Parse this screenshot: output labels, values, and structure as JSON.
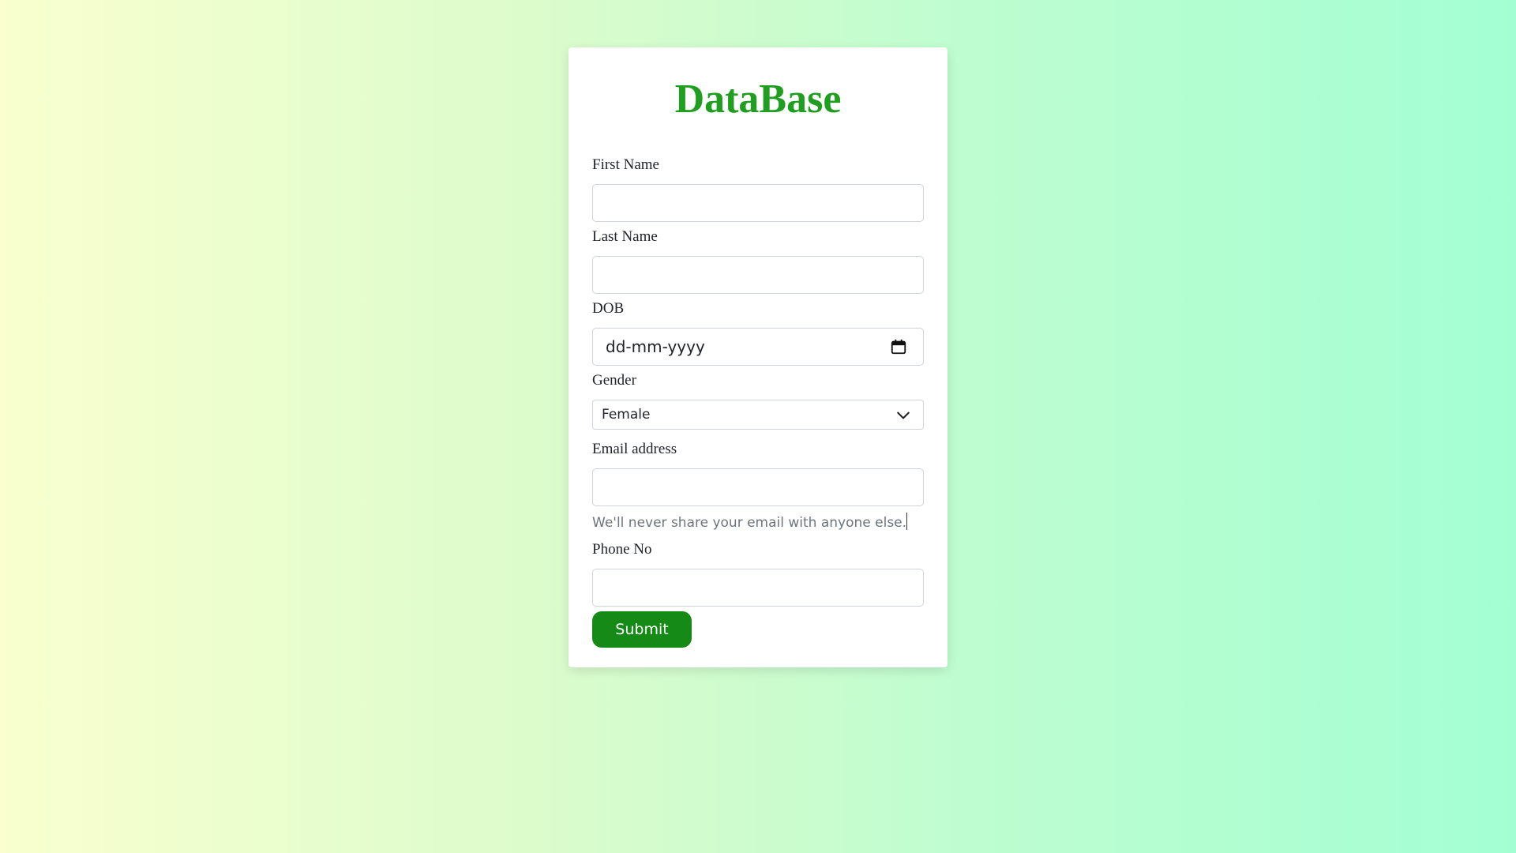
{
  "form": {
    "title": "DataBase",
    "first_name": {
      "label": "First Name",
      "value": ""
    },
    "last_name": {
      "label": "Last Name",
      "value": ""
    },
    "dob": {
      "label": "DOB",
      "placeholder": "dd-mm-yyyy"
    },
    "gender": {
      "label": "Gender",
      "selected": "Female"
    },
    "email": {
      "label": "Email address",
      "value": "",
      "help": "We'll never share your email with anyone else."
    },
    "phone": {
      "label": "Phone No",
      "value": ""
    },
    "submit_label": "Submit"
  },
  "colors": {
    "title": "#1f9e1f",
    "submit_bg": "#168a16",
    "help_text": "#6c757d"
  },
  "icons": {
    "date": "calendar-icon",
    "select": "chevron-down-icon"
  }
}
